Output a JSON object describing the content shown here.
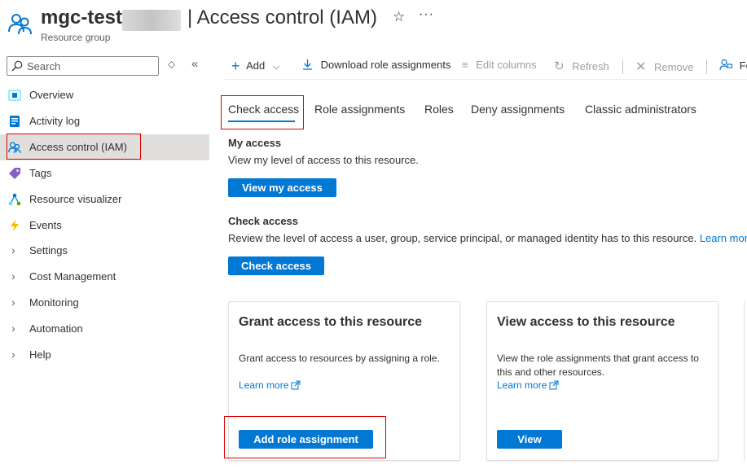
{
  "header": {
    "title": "mgc-test_",
    "page_title": "| Access control (IAM)",
    "subtitle": "Resource group"
  },
  "sidebar": {
    "search_placeholder": "Search",
    "items": [
      {
        "label": "Overview",
        "icon": "overview-icon"
      },
      {
        "label": "Activity log",
        "icon": "activity-log-icon"
      },
      {
        "label": "Access control (IAM)",
        "icon": "iam-icon",
        "selected": true
      },
      {
        "label": "Tags",
        "icon": "tag-icon"
      },
      {
        "label": "Resource visualizer",
        "icon": "visualizer-icon"
      },
      {
        "label": "Events",
        "icon": "events-icon"
      },
      {
        "label": "Settings",
        "icon": "chevron-right-icon"
      },
      {
        "label": "Cost Management",
        "icon": "chevron-right-icon"
      },
      {
        "label": "Monitoring",
        "icon": "chevron-right-icon"
      },
      {
        "label": "Automation",
        "icon": "chevron-right-icon"
      },
      {
        "label": "Help",
        "icon": "chevron-right-icon"
      }
    ]
  },
  "toolbar": {
    "add": "Add",
    "download": "Download role assignments",
    "edit_columns": "Edit columns",
    "refresh": "Refresh",
    "remove": "Remove",
    "feedback": "Fe"
  },
  "tabs": [
    "Check access",
    "Role assignments",
    "Roles",
    "Deny assignments",
    "Classic administrators"
  ],
  "my_access": {
    "title": "My access",
    "desc": "View my level of access to this resource.",
    "button": "View my access"
  },
  "check_access": {
    "title": "Check access",
    "desc": "Review the level of access a user, group, service principal, or managed identity has to this resource.",
    "link": "Learn more",
    "button": "Check access"
  },
  "cards": [
    {
      "title": "Grant access to this resource",
      "desc": "Grant access to resources by assigning a role.",
      "link": "Learn more",
      "button": "Add role assignment"
    },
    {
      "title": "View access to this resource",
      "desc": "View the role assignments that grant access to this and other resources.",
      "link": "Learn more",
      "button": "View"
    }
  ],
  "colors": {
    "accent": "#0078d4",
    "highlight": "#e00000",
    "selected_bg": "#e1dfdd"
  }
}
